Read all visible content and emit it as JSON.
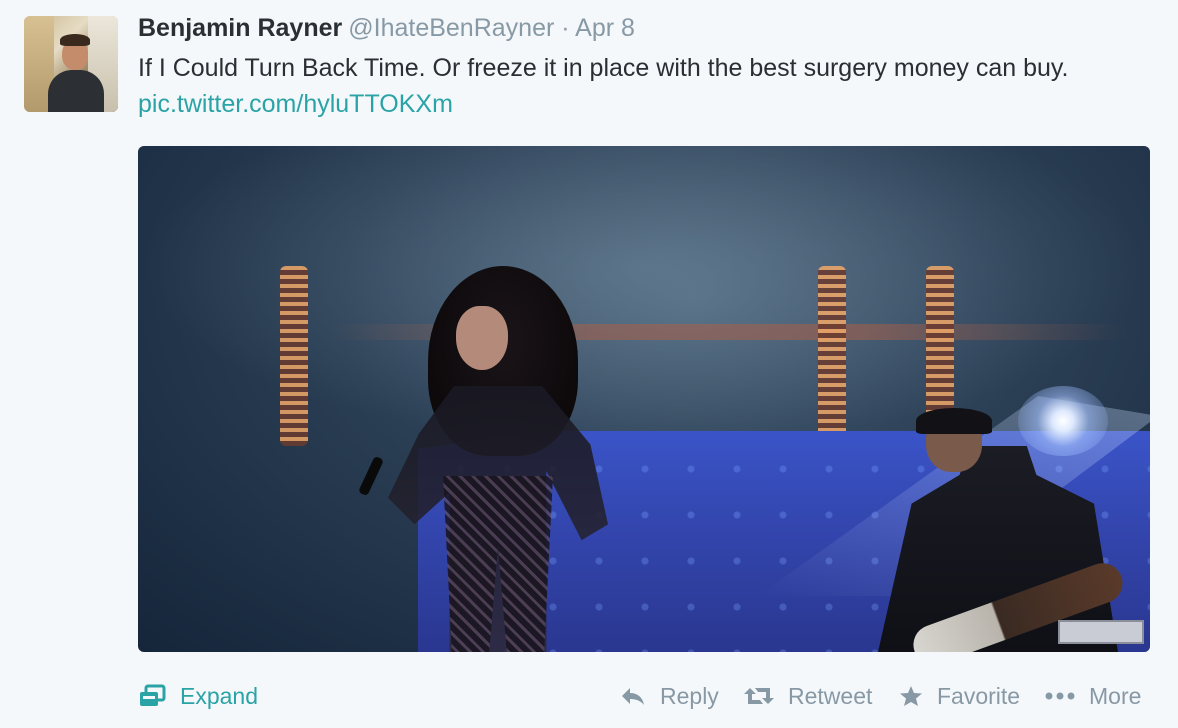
{
  "tweet": {
    "author_name": "Benjamin Rayner",
    "author_handle": "@IhateBenRayner",
    "separator": "·",
    "date": "Apr 8",
    "text": "If I Could Turn Back Time. Or freeze it in place with the best surgery money can buy.",
    "link_text": "pic.twitter.com/hyluTTOKXm"
  },
  "actions": {
    "expand": "Expand",
    "reply": "Reply",
    "retweet": "Retweet",
    "favorite": "Favorite",
    "more": "More"
  },
  "icons": {
    "avatar": "avatar-photo",
    "expand": "expand-icon",
    "reply": "reply-icon",
    "retweet": "retweet-icon",
    "favorite": "star-icon",
    "more": "more-dots-icon"
  },
  "colors": {
    "link": "#2aa3a6",
    "muted": "#8899a6",
    "text": "#292f33",
    "background": "#f5f8fa"
  }
}
